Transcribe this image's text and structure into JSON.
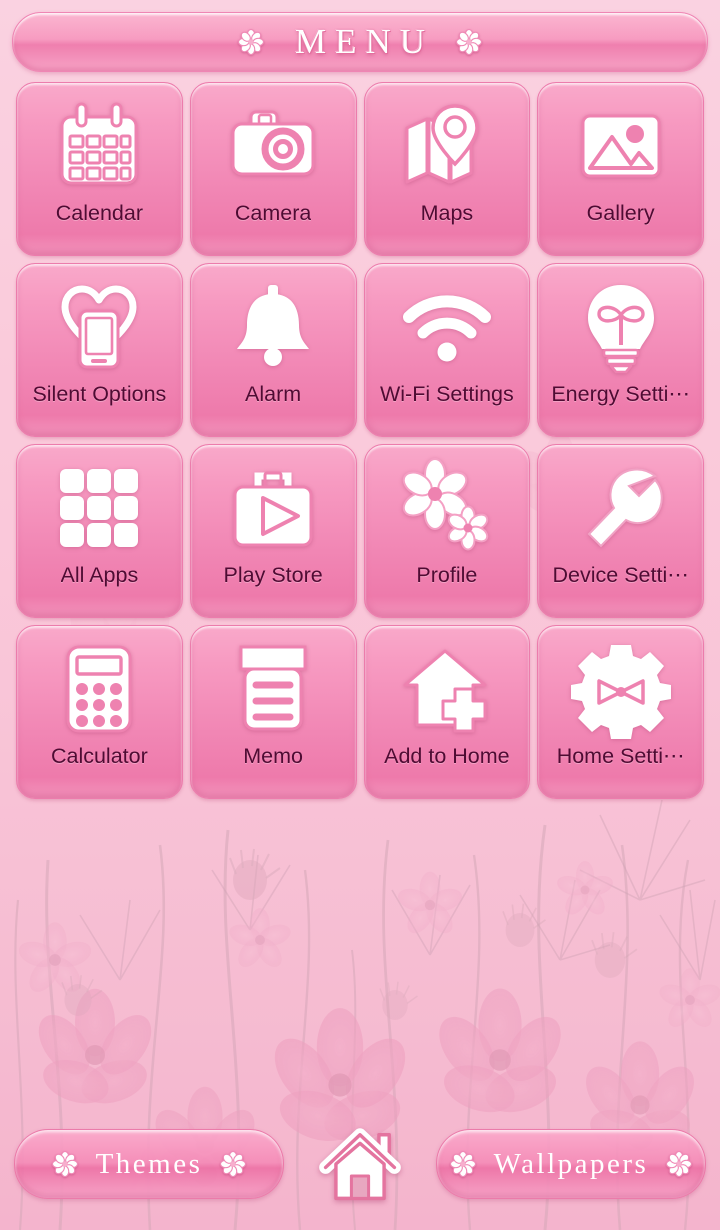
{
  "header": {
    "title": "MENU",
    "left_icon": "flower-icon",
    "right_icon": "flower-icon"
  },
  "apps": [
    {
      "label": "Calendar",
      "icon": "calendar-icon"
    },
    {
      "label": "Camera",
      "icon": "camera-icon"
    },
    {
      "label": "Maps",
      "icon": "map-pin-icon"
    },
    {
      "label": "Gallery",
      "icon": "image-icon"
    },
    {
      "label": "Silent Options",
      "icon": "phone-heart-icon"
    },
    {
      "label": "Alarm",
      "icon": "bell-icon"
    },
    {
      "label": "Wi-Fi Settings",
      "icon": "wifi-icon"
    },
    {
      "label": "Energy Setti⋯",
      "icon": "lightbulb-icon"
    },
    {
      "label": "All Apps",
      "icon": "grid-apps-icon"
    },
    {
      "label": "Play Store",
      "icon": "shopping-bag-play-icon"
    },
    {
      "label": "Profile",
      "icon": "flowers-icon"
    },
    {
      "label": "Device Setti⋯",
      "icon": "wrench-icon"
    },
    {
      "label": "Calculator",
      "icon": "calculator-icon"
    },
    {
      "label": "Memo",
      "icon": "notepad-icon"
    },
    {
      "label": "Add to Home",
      "icon": "house-plus-icon"
    },
    {
      "label": "Home Setti⋯",
      "icon": "gear-bow-icon"
    }
  ],
  "dock": {
    "themes_label": "Themes",
    "wallpapers_label": "Wallpapers",
    "home_icon": "home-icon",
    "flower_icon": "flower-icon"
  },
  "colors": {
    "tile_pink": "#f186b4",
    "tile_pink_light": "#f9a9ca",
    "label_maroon": "#4f0b33",
    "icon_white": "#ffffff",
    "icon_outline": "#ef7fae",
    "background_pink": "#f9c6d9"
  }
}
